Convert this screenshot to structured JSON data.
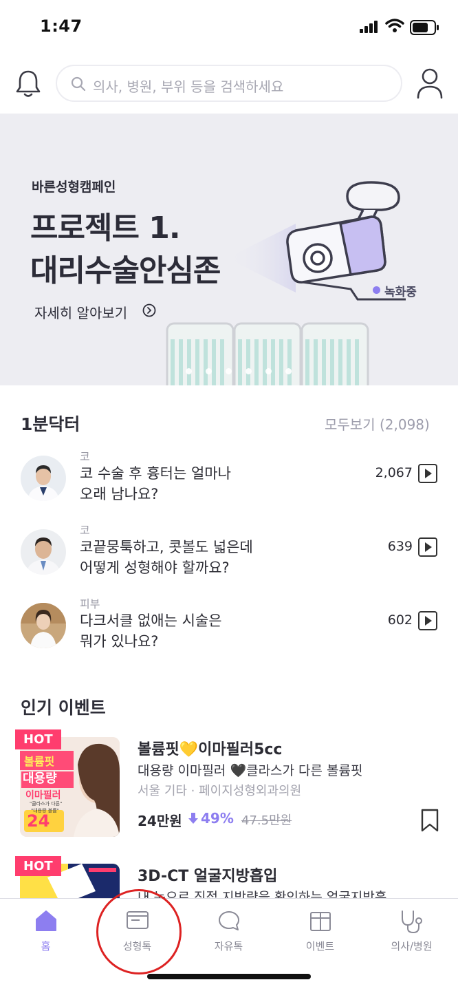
{
  "status_bar": {
    "time": "1:47"
  },
  "header": {
    "search_placeholder": "의사, 병원, 부위 등을 검색하세요"
  },
  "banner": {
    "campaign": "바른성형캠페인",
    "title_line1": "프로젝트 1.",
    "title_line2": "대리수술안심존",
    "more": "자세히 알아보기",
    "recording": "녹화중"
  },
  "doctor_section": {
    "title": "1분닥터",
    "see_all": "모두보기 (2,098)",
    "items": [
      {
        "category": "코",
        "question_line1": "코 수술 후 흉터는 얼마나",
        "question_line2": "오래 남나요?",
        "views": "2,067"
      },
      {
        "category": "코",
        "question_line1": "코끝뭉툭하고, 콧볼도 넓은데",
        "question_line2": "어떻게 성형해야 할까요?",
        "views": "639"
      },
      {
        "category": "피부",
        "question_line1": "다크서클 없애는 시술은",
        "question_line2": "뭐가 있나요?",
        "views": "602"
      }
    ]
  },
  "event_section": {
    "title": "인기 이벤트",
    "hot_label": "HOT",
    "items": [
      {
        "name": "볼륨핏💛이마필러5cc",
        "desc": "대용량 이마필러 🖤클라스가 다른 볼륨핏",
        "location": "서울 기타 · 페이지성형외과의원",
        "price": "24만원",
        "discount": "49%",
        "original_price": "47.5만원",
        "thumb_text": [
          "볼륨핏",
          "대용량",
          "이마필러",
          "\"클라스가 다른\"",
          "\"대용량 볼륨\"",
          "24"
        ]
      },
      {
        "name": "3D-CT 얼굴지방흡입",
        "desc": "내 눈으로 직접 지방량을 확인하는 얼굴지방흡…"
      }
    ]
  },
  "tabbar": {
    "items": [
      {
        "label": "홈",
        "icon": "home-icon"
      },
      {
        "label": "성형톡",
        "icon": "card-icon"
      },
      {
        "label": "자유톡",
        "icon": "chat-icon"
      },
      {
        "label": "이벤트",
        "icon": "gift-icon"
      },
      {
        "label": "의사/병원",
        "icon": "stethoscope-icon"
      }
    ]
  },
  "colors": {
    "accent": "#8d7ef0",
    "hot": "#ff3d6e",
    "annotation": "#dd2222"
  }
}
